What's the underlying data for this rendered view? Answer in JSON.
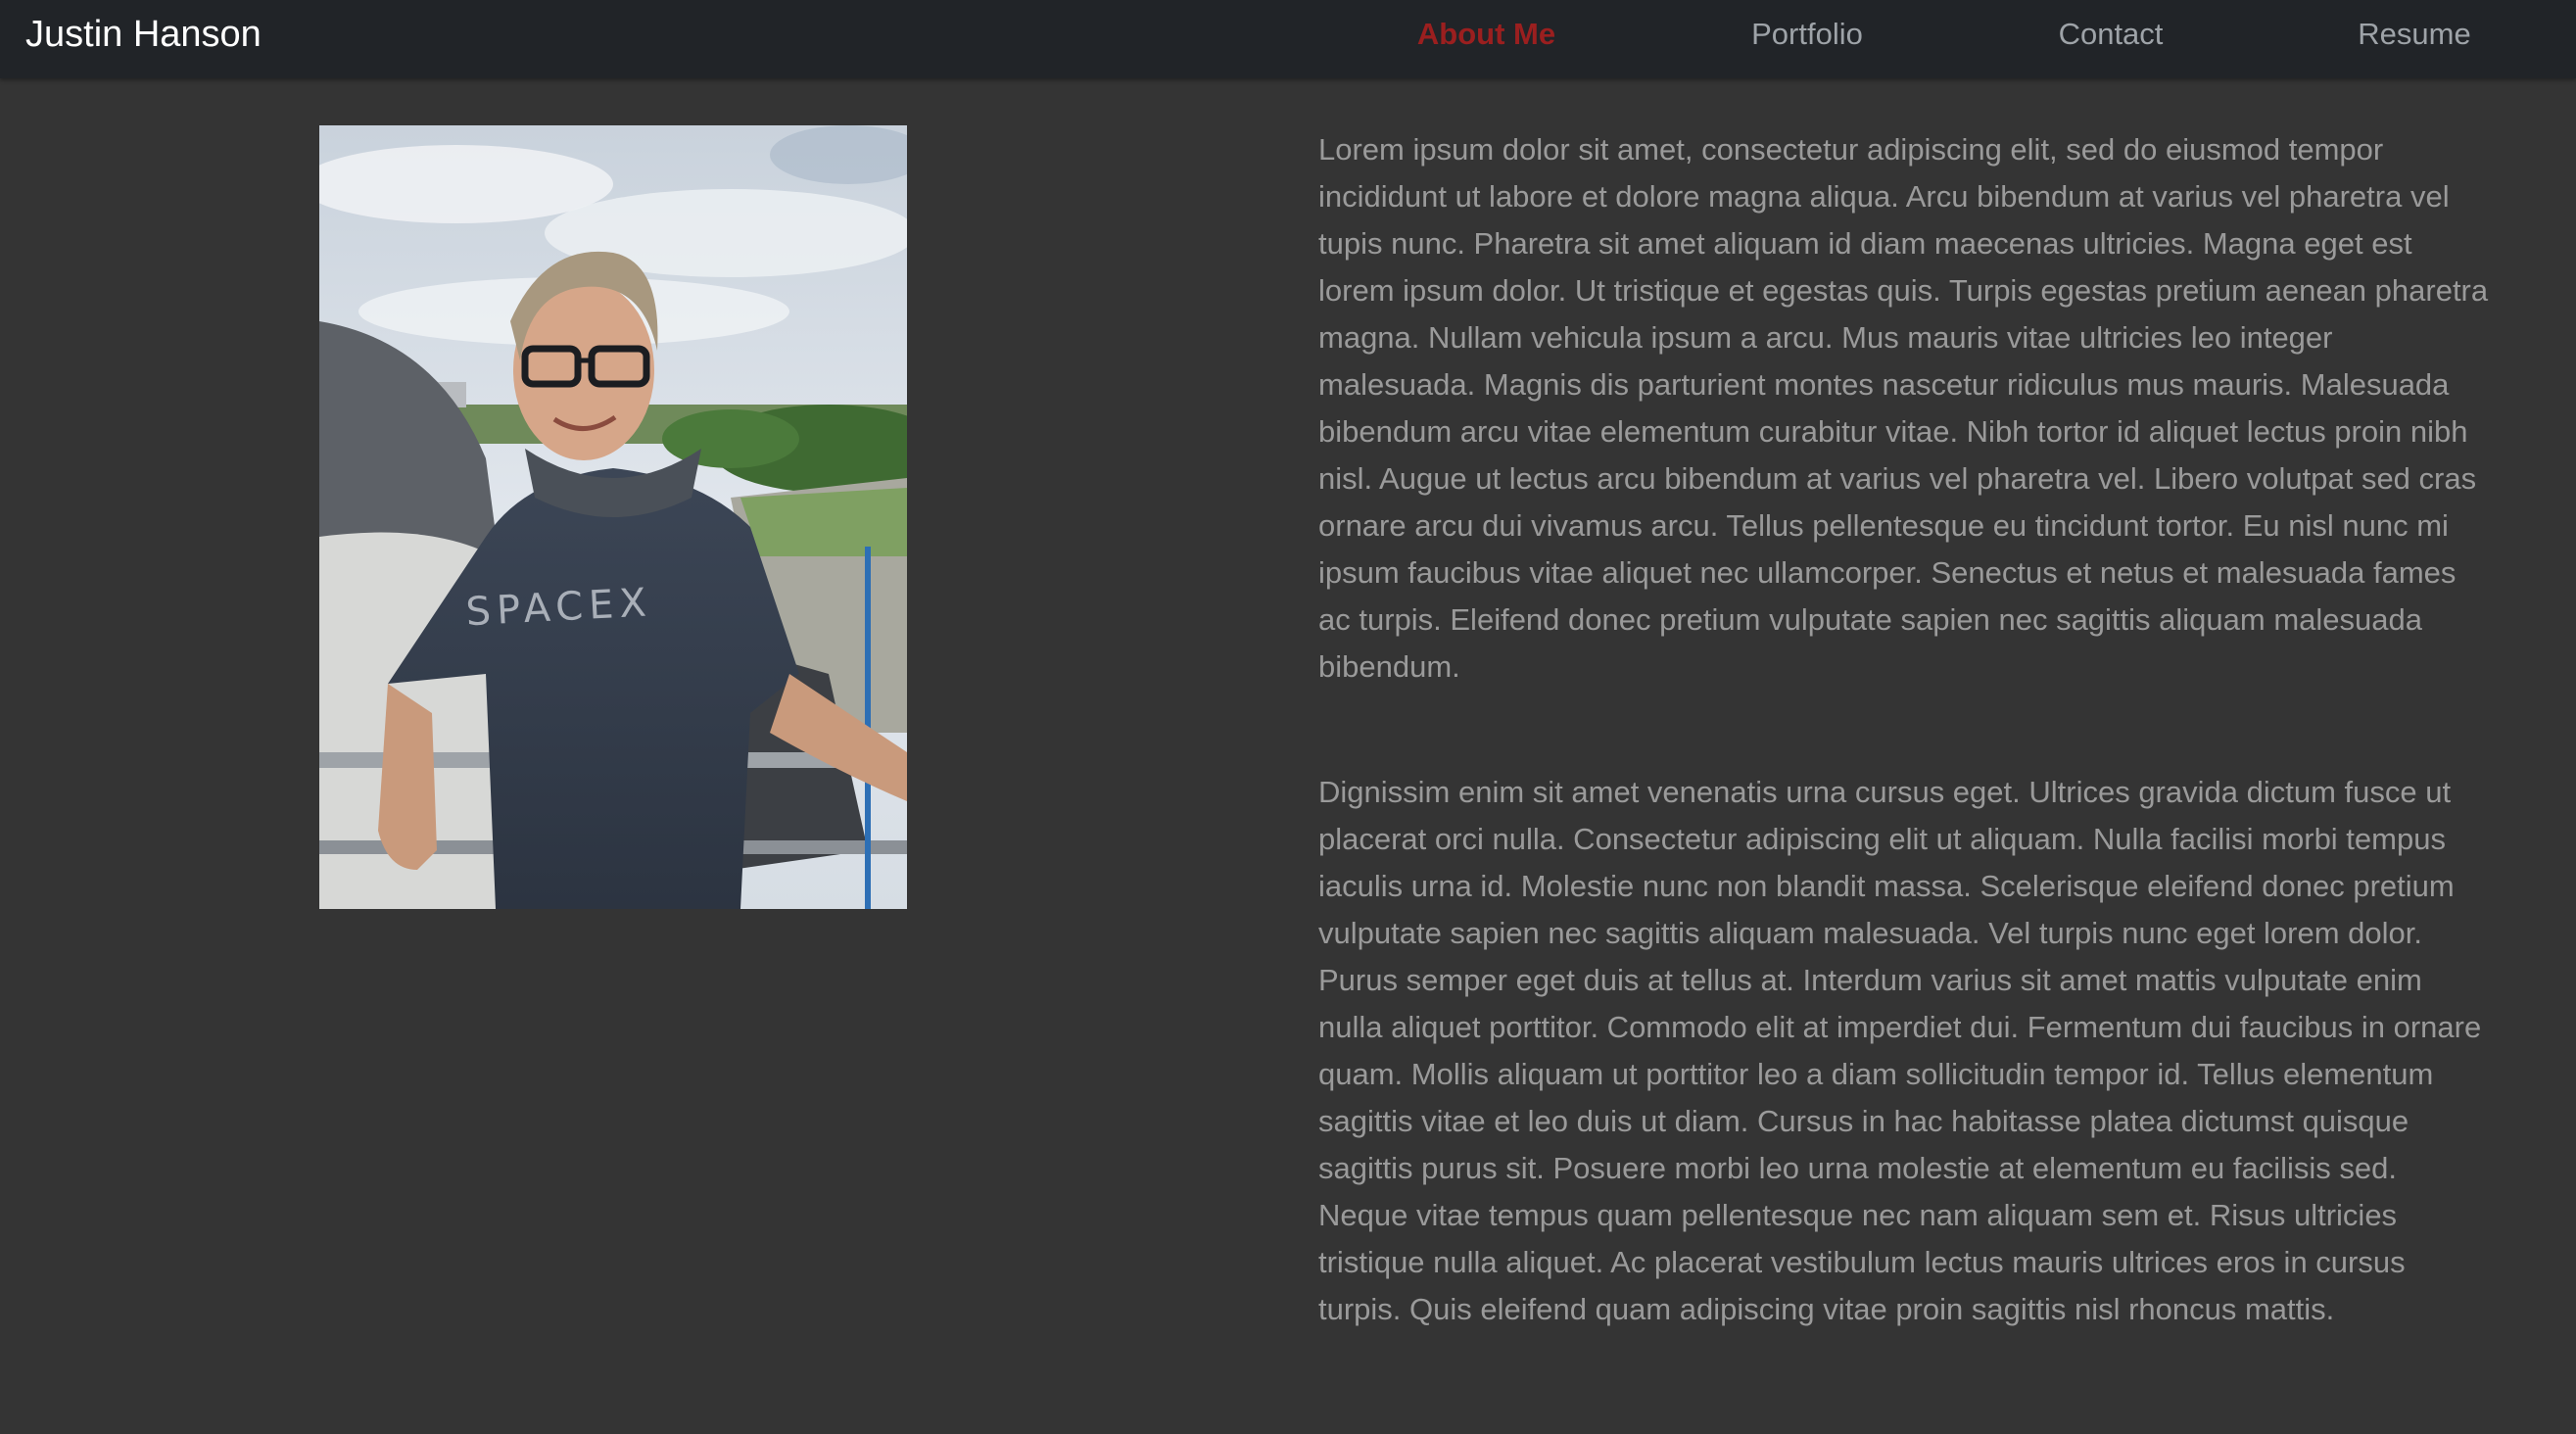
{
  "brand": "Justin Hanson",
  "nav": {
    "about": "About Me",
    "portfolio": "Portfolio",
    "contact": "Contact",
    "resume": "Resume"
  },
  "photo": {
    "shirt_text": "SPACEX"
  },
  "content": {
    "paragraph1": "Lorem ipsum dolor sit amet, consectetur adipiscing elit, sed do eiusmod tempor incididunt ut labore et dolore magna aliqua. Arcu bibendum at varius vel pharetra vel tupis nunc. Pharetra sit amet aliquam id diam maecenas ultricies. Magna eget est lorem ipsum dolor. Ut tristique et egestas quis. Turpis egestas pretium aenean pharetra magna. Nullam vehicula ipsum a arcu. Mus mauris vitae ultricies leo integer malesuada. Magnis dis parturient montes nascetur ridiculus mus mauris. Malesuada bibendum arcu vitae elementum curabitur vitae. Nibh tortor id aliquet lectus proin nibh nisl. Augue ut lectus arcu bibendum at varius vel pharetra vel. Libero volutpat sed cras ornare arcu dui vivamus arcu. Tellus pellentesque eu tincidunt tortor. Eu nisl nunc mi ipsum faucibus vitae aliquet nec ullamcorper. Senectus et netus et malesuada fames ac turpis. Eleifend donec pretium vulputate sapien nec sagittis aliquam malesuada bibendum.",
    "paragraph2": "Dignissim enim sit amet venenatis urna cursus eget. Ultrices gravida dictum fusce ut placerat orci nulla. Consectetur adipiscing elit ut aliquam. Nulla facilisi morbi tempus iaculis urna id. Molestie nunc non blandit massa. Scelerisque eleifend donec pretium vulputate sapien nec sagittis aliquam malesuada. Vel turpis nunc eget lorem dolor. Purus semper eget duis at tellus at. Interdum varius sit amet mattis vulputate enim nulla aliquet porttitor. Commodo elit at imperdiet dui. Fermentum dui faucibus in ornare quam. Mollis aliquam ut porttitor leo a diam sollicitudin tempor id. Tellus elementum sagittis vitae et leo duis ut diam. Cursus in hac habitasse platea dictumst quisque sagittis purus sit. Posuere morbi leo urna molestie at elementum eu facilisis sed. Neque vitae tempus quam pellentesque nec nam aliquam sem et. Risus ultricies tristique nulla aliquet. Ac placerat vestibulum lectus mauris ultrices eros in cursus turpis. Quis eleifend quam adipiscing vitae proin sagittis nisl rhoncus mattis."
  },
  "colors": {
    "background": "#343434",
    "navbar": "#212428",
    "active_link": "#9b1f1f",
    "nav_link": "#9ea3a8",
    "body_text": "#9a9a9a"
  }
}
